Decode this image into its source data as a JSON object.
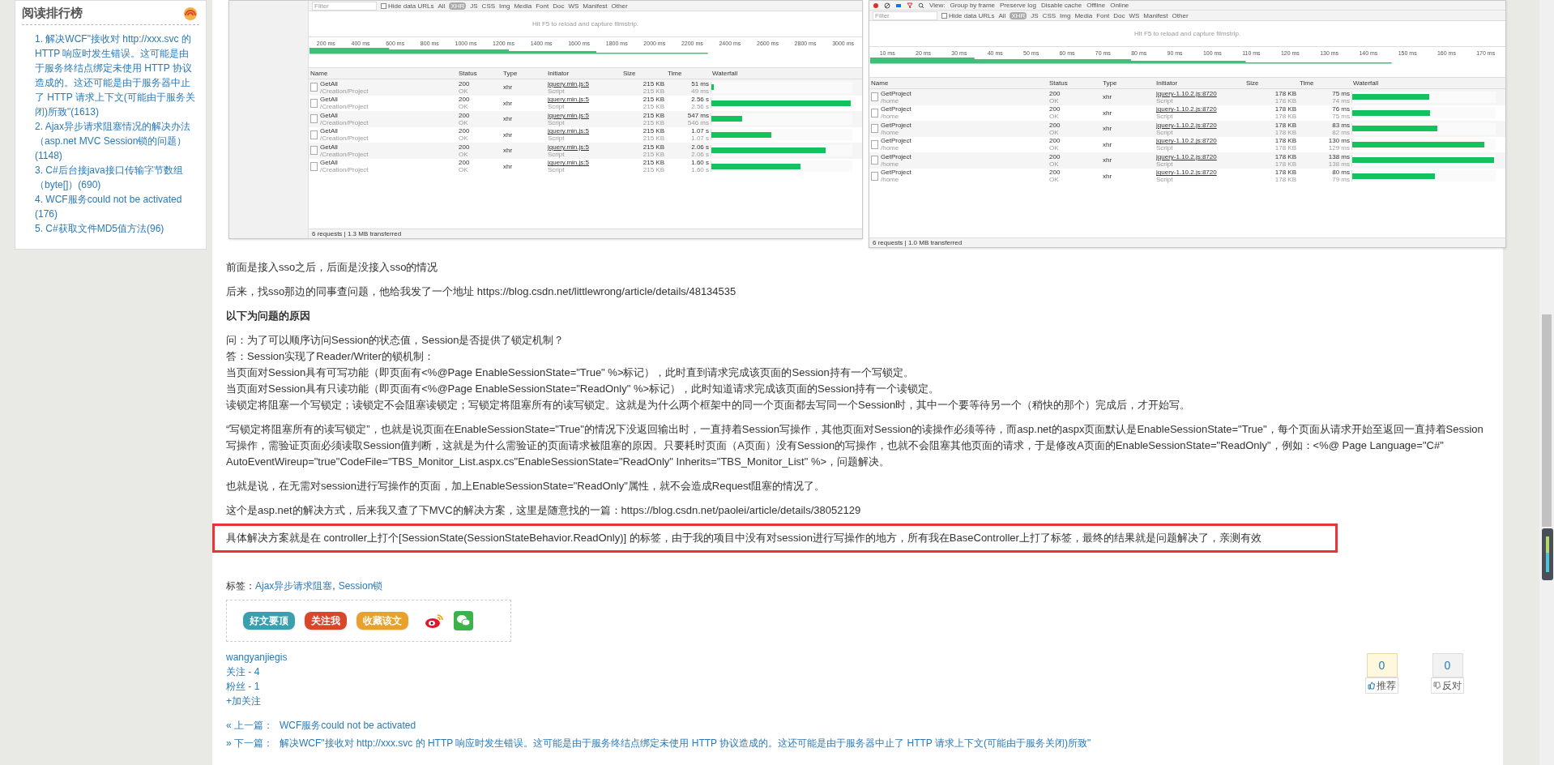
{
  "sidebar": {
    "title": "阅读排行榜",
    "items": [
      "1. 解决WCF\"接收对 http://xxx.svc 的 HTTP 响应时发生错误。这可能是由于服务终结点绑定未使用 HTTP 协议造成的。这还可能是由于服务器中止了 HTTP 请求上下文(可能由于服务关闭)所致\"(1613)",
      "2. Ajax异步请求阻塞情况的解决办法（asp.net MVC Session锁的问题）(1148)",
      "3. C#后台接java接口传输字节数组（byte[]）(690)",
      "4. WCF服务could not be activated (176)",
      "5. C#获取文件MD5值方法(96)"
    ]
  },
  "devtools": [
    {
      "hide_data_urls_checked": false,
      "filters": [
        "Filter",
        "Hide data URLs",
        "All",
        "XHR",
        "JS",
        "CSS",
        "Img",
        "Media",
        "Font",
        "Doc",
        "WS",
        "Manifest",
        "Other"
      ],
      "filmstrip_hint": "Hit F5 to reload and capture filmstrip.",
      "ticks": [
        "200 ms",
        "400 ms",
        "600 ms",
        "800 ms",
        "1000 ms",
        "1200 ms",
        "1400 ms",
        "1600 ms",
        "1800 ms",
        "2000 ms",
        "2200 ms",
        "2400 ms",
        "2600 ms",
        "2800 ms",
        "3000 ms"
      ],
      "columns": [
        "Name",
        "Status",
        "Type",
        "Initiator",
        "Size",
        "Time",
        "Waterfall"
      ],
      "rows": [
        {
          "name": "GetAll",
          "path": "/Creation/Project",
          "status": "200",
          "status_text": "OK",
          "type": "xhr",
          "initiator": "jquery.min.js:5",
          "initiator_type": "Script",
          "size": "215 KB",
          "content": "215 KB",
          "time": "51 ms",
          "latency": "49 ms",
          "level": 0.02
        },
        {
          "name": "GetAll",
          "path": "/Creation/Project",
          "status": "200",
          "status_text": "OK",
          "type": "xhr",
          "initiator": "jquery.min.js:5",
          "initiator_type": "Script",
          "size": "215 KB",
          "content": "215 KB",
          "time": "2.56 s",
          "latency": "2.56 s",
          "level": 1.0
        },
        {
          "name": "GetAll",
          "path": "/Creation/Project",
          "status": "200",
          "status_text": "OK",
          "type": "xhr",
          "initiator": "jquery.min.js:5",
          "initiator_type": "Script",
          "size": "215 KB",
          "content": "215 KB",
          "time": "547 ms",
          "latency": "546 ms",
          "level": 0.22
        },
        {
          "name": "GetAll",
          "path": "/Creation/Project",
          "status": "200",
          "status_text": "OK",
          "type": "xhr",
          "initiator": "jquery.min.js:5",
          "initiator_type": "Script",
          "size": "215 KB",
          "content": "215 KB",
          "time": "1.07 s",
          "latency": "1.07 s",
          "level": 0.43
        },
        {
          "name": "GetAll",
          "path": "/Creation/Project",
          "status": "200",
          "status_text": "OK",
          "type": "xhr",
          "initiator": "jquery.min.js:5",
          "initiator_type": "Script",
          "size": "215 KB",
          "content": "215 KB",
          "time": "2.06 s",
          "latency": "2.06 s",
          "level": 0.82
        },
        {
          "name": "GetAll",
          "path": "/Creation/Project",
          "status": "200",
          "status_text": "OK",
          "type": "xhr",
          "initiator": "jquery.min.js:5",
          "initiator_type": "Script",
          "size": "215 KB",
          "content": "215 KB",
          "time": "1.60 s",
          "latency": "1.60 s",
          "level": 0.64
        }
      ],
      "summary": "6 requests | 1.3 MB transferred"
    },
    {
      "toolbar": [
        "View:",
        "Group by frame",
        "Preserve log",
        "Disable cache",
        "Offline",
        "Online"
      ],
      "hide_data_urls_checked": false,
      "filters": [
        "Filter",
        "Hide data URLs",
        "All",
        "XHR",
        "JS",
        "CSS",
        "Img",
        "Media",
        "Font",
        "Doc",
        "WS",
        "Manifest",
        "Other"
      ],
      "filmstrip_hint": "Hit F5 to reload and capture filmstrip.",
      "ticks": [
        "10 ms",
        "20 ms",
        "30 ms",
        "40 ms",
        "50 ms",
        "60 ms",
        "70 ms",
        "80 ms",
        "90 ms",
        "100 ms",
        "110 ms",
        "120 ms",
        "130 ms",
        "140 ms",
        "150 ms",
        "160 ms",
        "170 ms"
      ],
      "columns": [
        "Name",
        "Status",
        "Type",
        "Initiator",
        "Size",
        "Time",
        "Waterfall"
      ],
      "rows": [
        {
          "name": "GetProject",
          "path": "/home",
          "status": "200",
          "status_text": "OK",
          "type": "xhr",
          "initiator": "jquery-1.10.2.js:8720",
          "initiator_type": "Script",
          "size": "178 KB",
          "content": "178 KB",
          "time": "75 ms",
          "latency": "74 ms",
          "level": 0.54
        },
        {
          "name": "GetProject",
          "path": "/home",
          "status": "200",
          "status_text": "OK",
          "type": "xhr",
          "initiator": "jquery-1.10.2.js:8720",
          "initiator_type": "Script",
          "size": "178 KB",
          "content": "178 KB",
          "time": "76 ms",
          "latency": "75 ms",
          "level": 0.55
        },
        {
          "name": "GetProject",
          "path": "/home",
          "status": "200",
          "status_text": "OK",
          "type": "xhr",
          "initiator": "jquery-1.10.2.js:8720",
          "initiator_type": "Script",
          "size": "178 KB",
          "content": "178 KB",
          "time": "83 ms",
          "latency": "82 ms",
          "level": 0.6
        },
        {
          "name": "GetProject",
          "path": "/home",
          "status": "200",
          "status_text": "OK",
          "type": "xhr",
          "initiator": "jquery-1.10.2.js:8720",
          "initiator_type": "Script",
          "size": "178 KB",
          "content": "178 KB",
          "time": "130 ms",
          "latency": "129 ms",
          "level": 0.93
        },
        {
          "name": "GetProject",
          "path": "/home",
          "status": "200",
          "status_text": "OK",
          "type": "xhr",
          "initiator": "jquery-1.10.2.js:8720",
          "initiator_type": "Script",
          "size": "178 KB",
          "content": "178 KB",
          "time": "138 ms",
          "latency": "138 ms",
          "level": 1.0
        },
        {
          "name": "GetProject",
          "path": "/home",
          "status": "200",
          "status_text": "OK",
          "type": "xhr",
          "initiator": "jquery-1.10.2.js:8720",
          "initiator_type": "Script",
          "size": "178 KB",
          "content": "178 KB",
          "time": "80 ms",
          "latency": "79 ms",
          "level": 0.58
        }
      ],
      "summary": "6 requests | 1.0 MB transferred"
    }
  ],
  "article": [
    {
      "kind": "text",
      "lines": [
        "前面是接入sso之后，后面是没接入sso的情况"
      ]
    },
    {
      "kind": "text",
      "lines": [
        "后来，找sso那边的同事查问题，他给我发了一个地址 https://blog.csdn.net/littlewrong/article/details/48134535"
      ]
    },
    {
      "kind": "heading",
      "lines": [
        "以下为问题的原因"
      ]
    },
    {
      "kind": "text",
      "lines": [
        "问：为了可以顺序访问Session的状态值，Session是否提供了锁定机制？",
        "答：Session实现了Reader/Writer的锁机制：",
        "当页面对Session具有可写功能（即页面有<%@Page EnableSessionState=\"True\" %>标记），此时直到请求完成该页面的Session持有一个写锁定。",
        "当页面对Session具有只读功能（即页面有<%@Page EnableSessionState=\"ReadOnly\" %>标记），此时知道请求完成该页面的Session持有一个读锁定。",
        "读锁定将阻塞一个写锁定；读锁定不会阻塞读锁定；写锁定将阻塞所有的读写锁定。这就是为什么两个框架中的同一个页面都去写同一个Session时，其中一个要等待另一个（稍快的那个）完成后，才开始写。"
      ]
    },
    {
      "kind": "text",
      "lines": [
        "“写锁定将阻塞所有的读写锁定”，也就是说页面在EnableSessionState=\"True\"的情况下没返回输出时，一直持着Session写操作，其他页面对Session的读操作必须等待，而asp.net的aspx页面默认是EnableSessionState=\"True\"，每个页面从请求开始至返回一直持着Session写操作，需验证页面必须读取Session值判断，这就是为什么需验证的页面请求被阻塞的原因。只要耗时页面（A页面）没有Session的写操作，也就不会阻塞其他页面的请求，于是修改A页面的EnableSessionState=\"ReadOnly\"，例如：<%@ Page Language=\"C#\" AutoEventWireup=\"true\"CodeFile=\"TBS_Monitor_List.aspx.cs\"EnableSessionState=\"ReadOnly\" Inherits=\"TBS_Monitor_List\" %>，问题解决。"
      ]
    },
    {
      "kind": "text",
      "lines": [
        "也就是说，在无需对session进行写操作的页面，加上EnableSessionState=\"ReadOnly\"属性，就不会造成Request阻塞的情况了。"
      ]
    },
    {
      "kind": "text",
      "lines": [
        "这个是asp.net的解决方式，后来我又查了下MVC的解决方案，这里是随意找的一篇：https://blog.csdn.net/paolei/article/details/38052129"
      ]
    },
    {
      "kind": "highlight",
      "lines": [
        "具体解决方案就是在 controller上打个[SessionState(SessionStateBehavior.ReadOnly)] 的标签，由于我的项目中没有对session进行写操作的地方，所有我在BaseController上打了标签，最终的结果就是问题解决了，亲测有效"
      ]
    }
  ],
  "tags": {
    "label": "标签：",
    "separator": ",",
    "items": [
      "Ajax异步请求阻塞",
      "Session锁"
    ]
  },
  "share_buttons": [
    {
      "label": "好文要顶",
      "color": "#3a9fae"
    },
    {
      "label": "关注我",
      "color": "#d9472b"
    },
    {
      "label": "收藏该文",
      "color": "#e8a12c"
    }
  ],
  "author": {
    "name": "wangyanjiegis",
    "following": "关注 - 4",
    "followers": "粉丝 - 1",
    "follow": "+加关注"
  },
  "votes": [
    {
      "kind": "up",
      "count": "0",
      "label": "推荐"
    },
    {
      "kind": "down",
      "count": "0",
      "label": "反对"
    }
  ],
  "nav": [
    {
      "prefix": "« 上一篇：",
      "title": "WCF服务could not be activated"
    },
    {
      "prefix": "» 下一篇：",
      "title": "解决WCF\"接收对 http://xxx.svc 的 HTTP 响应时发生错误。这可能是由于服务终结点绑定未使用 HTTP 协议造成的。这还可能是由于服务器中止了 HTTP 请求上下文(可能由于服务关闭)所致\""
    }
  ]
}
